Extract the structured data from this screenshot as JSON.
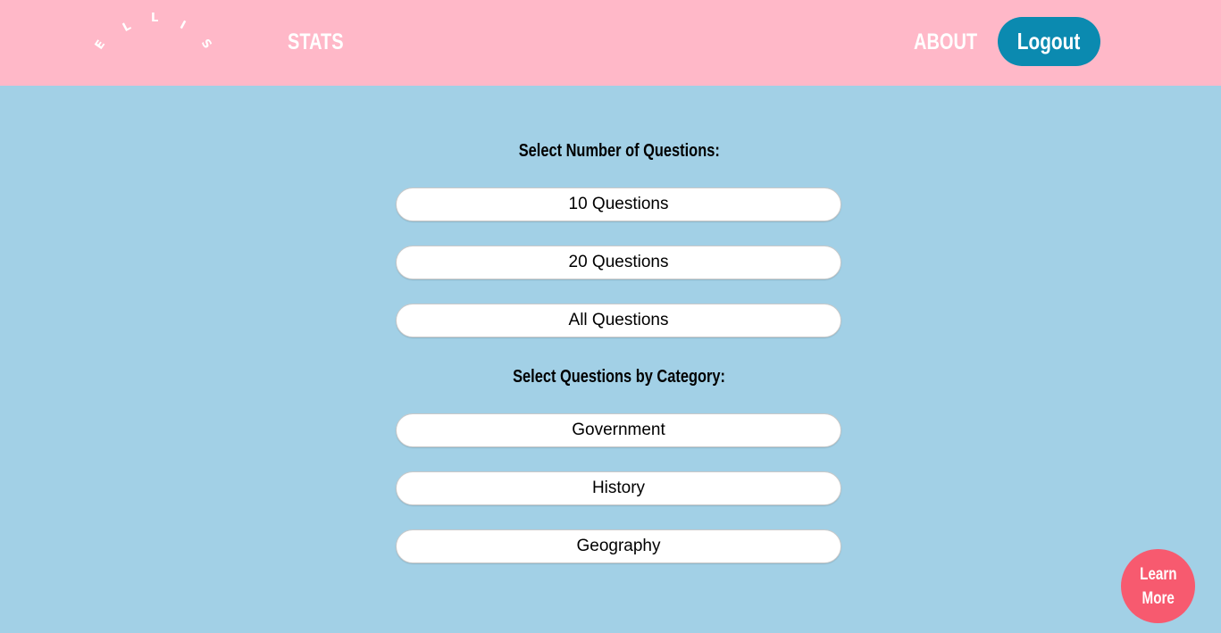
{
  "header": {
    "logo_letters": [
      "E",
      "L",
      "L",
      "I",
      "S"
    ],
    "nav_stats": "STATS",
    "nav_about": "ABOUT",
    "logout": "Logout"
  },
  "main": {
    "count_title": "Select Number of Questions:",
    "count_options": [
      "10 Questions",
      "20 Questions",
      "All Questions"
    ],
    "category_title": "Select Questions by Category:",
    "category_options": [
      "Government",
      "History",
      "Geography"
    ]
  },
  "fab": {
    "line1": "Learn",
    "line2": "More"
  },
  "colors": {
    "header_bg": "#ffb8c8",
    "page_bg": "#a2d0e6",
    "logout_bg": "#0b8ab0",
    "learn_more_bg": "#f75a6f"
  }
}
